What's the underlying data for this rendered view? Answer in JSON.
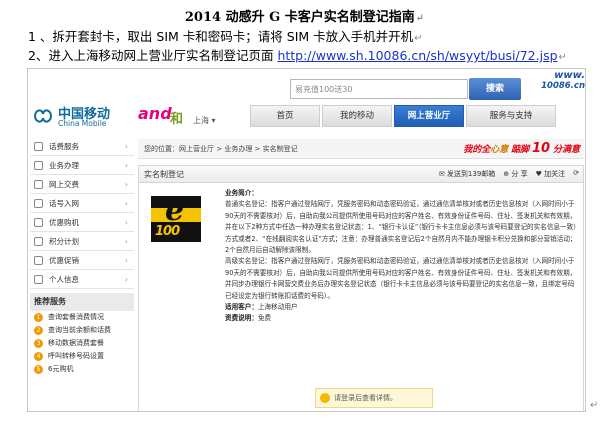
{
  "doc": {
    "title": "2014 动感升 G 卡客户实名制登记指南",
    "line1": "1 、拆开套封卡，取出 SIM 卡和密码卡；请将 SIM 卡放入手机并开机",
    "line2_prefix": "2、进入上海移动网上营业厅实名制登记页面 ",
    "line2_link": "http://www.sh.10086.cn/sh/wsyyt/busi/72.jsp"
  },
  "screenshot": {
    "search": {
      "placeholder": "易充值100送30",
      "button": "搜索",
      "url_logo_top": "www.",
      "url_logo_bottom": "10086.cn"
    },
    "header": {
      "logo_cn": "中国移动",
      "logo_en": "China Mobile",
      "and_logo": "and",
      "and_logo_he": "和",
      "region": "上海 ▾",
      "nav": [
        "首页",
        "我的移动",
        "网上营业厅",
        "服务与支持"
      ]
    },
    "sidebar": {
      "items": [
        "话费服务",
        "业务办理",
        "网上交费",
        "话号入网",
        "优惠购机",
        "积分计划",
        "优惠促销",
        "个人信息"
      ],
      "recommend_title": "推荐服务",
      "recommend": [
        "查询套餐消费情况",
        "查询当前余额和话费",
        "移动数据消费套餐",
        "呼叫转移号码设置",
        "6元购机"
      ]
    },
    "breadcrumb": "您的位置：网上营业厅 > 业务办理 > 实名制登记",
    "promo": {
      "part1": "我的全",
      "part2": "心意",
      "part3": "踮脚",
      "part4": "10",
      "part5": "分满意"
    },
    "panel": {
      "title": "实名制登记",
      "tools": [
        "发送到139邮箱",
        "分 享",
        "加关注"
      ],
      "intro_label": "业务简介：",
      "para1": "普通实名登记：指客户通过登陆网厅，凭服务密码和动态密码验证，通过通信清单核对或者历史信息核对（入网时间小于90天的不需要核对）后，自助向我公司提供所使用号码对应的客户姓名、有效身份证件号码、住址、签发机关和有效期，并在以下2种方式中任选一种办理实名登记状态：1、“银行卡认证”（银行卡卡主信息必须与该号码要登记的实名信息一致）方式或者2、“在线翻阅实名认证”方式；注意：办理普通实名登记后2个自然月内不能办理银卡积分兑换和部分营销活动；2个自然月后自动解除该限制。",
      "para2": "高级实名登记：指客户通过登陆网厅，凭服务密码和动态密码验证，通过通信清单核对或者历史信息核对（入网时间小于90天的不需要核对）后，自助向我公司提供所使用号码对应的客户姓名、有效身份证件号码、住址、签发机关和有效期，并同步办理银行卡网营交费业务后办理实名登记状态（银行卡卡主信息必须与该号码要登记的实名信息一致，且绑定号码已经设定为银行转账扣话费的号码）。",
      "target_label": "适用客户：",
      "target_value": "上海移动用户",
      "fee_label": "资费说明：",
      "fee_value": "免费",
      "notice": "请登录后查看详情。"
    }
  }
}
